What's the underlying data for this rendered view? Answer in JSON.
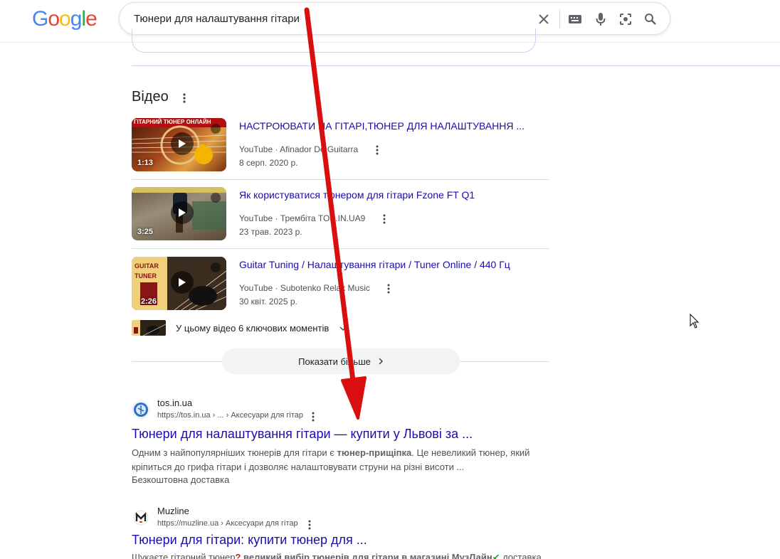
{
  "search": {
    "query": "Тюнери для налаштування гітари",
    "logo_letters": [
      "G",
      "o",
      "o",
      "g",
      "l",
      "e"
    ],
    "logo_colors": [
      "#4285F4",
      "#EA4335",
      "#FBBC05",
      "#4285F4",
      "#34A853",
      "#EA4335"
    ]
  },
  "videos": {
    "heading": "Відео",
    "items": [
      {
        "title": "НАСТРОЮВАТИ НА ГІТАРІ,ТЮНЕР ДЛЯ НАЛАШТУВАННЯ ...",
        "source": "YouTube · Afinador De Guitarra",
        "date": "8 серп. 2020 р.",
        "duration": "1:13",
        "thumb_caption": "ГІТАРНИЙ ТЮНЕР ОНЛАЙН"
      },
      {
        "title": "Як користуватися тюнером для гітари Fzone FT Q1",
        "source": "YouTube · Трембіта TOS.IN.UA9",
        "date": "23 трав. 2023 р.",
        "duration": "3:25",
        "thumb_caption": ""
      },
      {
        "title": "Guitar Tuning / Налаштування гітари / Tuner Online / 440 Гц",
        "source": "YouTube · Subotenko Relax Music",
        "date": "30 квіт. 2025 р.",
        "duration": "2:26",
        "thumb_caption": "GUITAR TUNER"
      }
    ],
    "key_moments": "У цьому відео 6 ключових моментів",
    "show_more": "Показати більше"
  },
  "results": [
    {
      "site": "tos.in.ua",
      "url": "https://tos.in.ua › ... › Аксесуари для гітар",
      "title": "Тюнери для налаштування гітари — купити у Львові за ...",
      "snippet_pre": "Одним з найпопулярніших тюнерів для гітари є ",
      "snippet_bold": "тюнер-прищіпка",
      "snippet_post": ". Це невеликий тюнер, який кріпиться до грифа гітари і дозволяє налаштовувати струни на різні висоти ...",
      "extra": "Безкоштовна доставка"
    },
    {
      "site": "Muzline",
      "url": "https://muzline.ua › Аксесуари для гітар",
      "title": "Тюнери для гітари: купити тюнер для ...",
      "snippet_pre": "Шукаєте гітарний тюнер",
      "snippet_bold": " великий вибір тюнерів для гітари в магазині МузЛайн",
      "snippet_post": " доставка",
      "extra": ""
    }
  ],
  "colors": {
    "link": "#1a0dab",
    "annotation_arrow": "#d90f0f"
  }
}
